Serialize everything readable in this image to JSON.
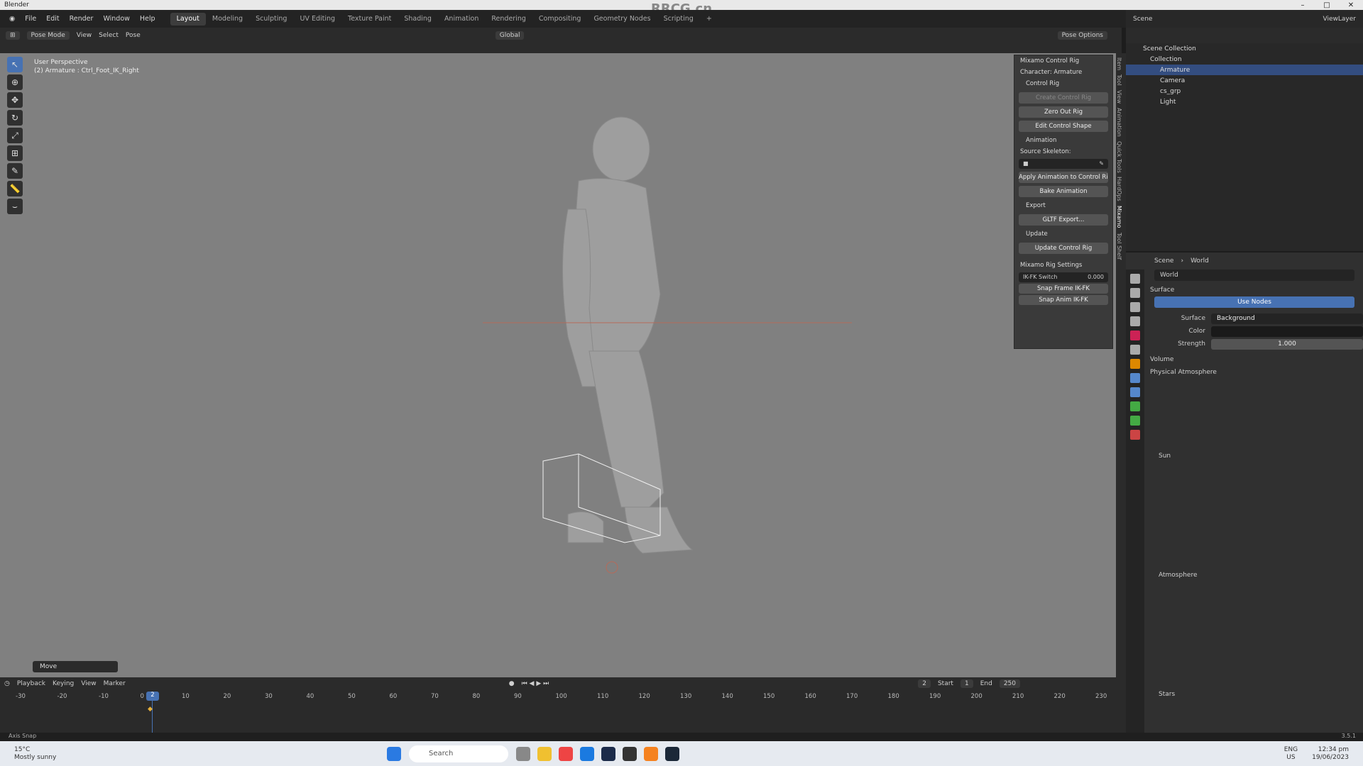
{
  "window": {
    "title": "Blender",
    "watermark": "RRCG.cn"
  },
  "menu": {
    "items": [
      "File",
      "Edit",
      "Render",
      "Window",
      "Help"
    ]
  },
  "workspaces": {
    "active": "Layout",
    "tabs": [
      "Layout",
      "Modeling",
      "Sculpting",
      "UV Editing",
      "Texture Paint",
      "Shading",
      "Animation",
      "Rendering",
      "Compositing",
      "Geometry Nodes",
      "Scripting"
    ]
  },
  "header": {
    "mode": "Pose Mode",
    "view": "View",
    "select": "Select",
    "pose": "Pose",
    "orientation": "Global",
    "pose_options": "Pose Options"
  },
  "viewport": {
    "line1": "User Perspective",
    "line2": "(2) Armature : Ctrl_Foot_IK_Right",
    "last_op": "Move"
  },
  "npanel": {
    "title": "Mixamo Control Rig",
    "character": "Character: Armature",
    "control_rig": "Control Rig",
    "create_control_rig": "Create Control Rig",
    "zero_out_rig": "Zero Out Rig",
    "edit_control_shape": "Edit Control Shape",
    "animation": "Animation",
    "source_skeleton": "Source Skeleton:",
    "apply_anim": "Apply Animation to Control Rig",
    "bake_anim": "Bake Animation",
    "export": "Export",
    "gltf_export": "GLTF Export...",
    "update": "Update",
    "update_control_rig": "Update Control Rig",
    "settings": "Mixamo Rig Settings",
    "ik_fk_label": "IK-FK Switch",
    "ik_fk_value": "0.000",
    "snap_frame": "Snap Frame IK-FK",
    "snap_anim": "Snap Anim IK-FK"
  },
  "sidetabs": [
    "Item",
    "Tool",
    "View",
    "Animation",
    "Quick Tools",
    "HardOps",
    "Mixamo",
    "Tool Shelf"
  ],
  "outliner": {
    "scene": "Scene",
    "view_layer": "ViewLayer",
    "rows": [
      "Scene Collection",
      "Collection",
      "Armature",
      "Camera",
      "cs_grp",
      "Light"
    ]
  },
  "properties": {
    "breadcrumb_scene": "Scene",
    "breadcrumb_world": "World",
    "world_name": "World",
    "surface_section": "Surface",
    "use_nodes": "Use Nodes",
    "surface_label": "Surface",
    "surface_value": "Background",
    "color_label": "Color",
    "strength_label": "Strength",
    "strength_value": "1.000",
    "volume": "Volume",
    "physical_atmosphere": "Physical Atmosphere",
    "sun": "Sun",
    "atmosphere": "Atmosphere",
    "stars": "Stars"
  },
  "timeline": {
    "menus": [
      "Playback",
      "Keying",
      "View",
      "Marker"
    ],
    "current": "2",
    "start_label": "Start",
    "start": "1",
    "end_label": "End",
    "end": "250",
    "ticks": [
      "-30",
      "-20",
      "-10",
      "0",
      "10",
      "20",
      "30",
      "40",
      "50",
      "60",
      "70",
      "80",
      "90",
      "100",
      "110",
      "120",
      "130",
      "140",
      "150",
      "160",
      "170",
      "180",
      "190",
      "200",
      "210",
      "220",
      "230"
    ]
  },
  "status": {
    "left": "Axis Snap",
    "version": "3.5.1"
  },
  "taskbar": {
    "weather_temp": "15°C",
    "weather_desc": "Mostly sunny",
    "search": "Search",
    "lang": "ENG",
    "region": "US",
    "time": "12:34 pm",
    "date": "19/06/2023"
  }
}
